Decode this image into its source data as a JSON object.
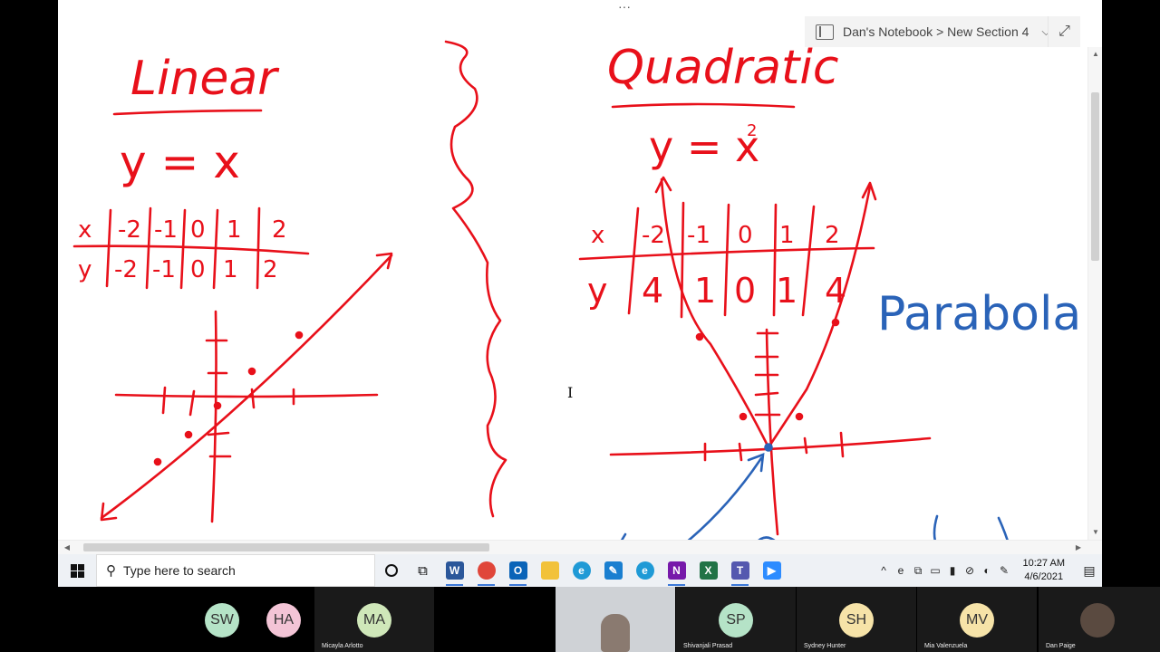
{
  "onenote": {
    "top_dots": "···",
    "notebook_path": "Dan's Notebook > New Section 4",
    "nb_caret": "⌵",
    "expand_glyph": "⤢",
    "close_glyph": "✕",
    "ibeam": "I"
  },
  "handwriting": {
    "linear_title": "Linear",
    "linear_eq": "y = x",
    "linear_x_row": [
      "x",
      "-2",
      "-1",
      "0",
      "1",
      "2"
    ],
    "linear_y_row": [
      "y",
      "-2",
      "-1",
      "0",
      "1",
      "2"
    ],
    "quadratic_title": "Quadratic",
    "quadratic_eq": "y = x",
    "quadratic_exp": "2",
    "quad_x_row": [
      "x",
      "-2",
      "-1",
      "0",
      "1",
      "2"
    ],
    "quad_y_row": [
      "y",
      "4",
      "1",
      "0",
      "1",
      "4"
    ],
    "parabola_label": "Parabola",
    "ink_red": "#e8101a",
    "ink_blue": "#2a63b8"
  },
  "taskbar": {
    "search_placeholder": "Type here to search",
    "apps": [
      {
        "name": "word-icon",
        "letter": "W",
        "color": "#2b579a"
      },
      {
        "name": "chrome-icon",
        "letter": "",
        "color": "#e0463a"
      },
      {
        "name": "outlook-icon",
        "letter": "O",
        "color": "#0a64b8"
      },
      {
        "name": "file-explorer-icon",
        "letter": "",
        "color": "#f2c23a"
      },
      {
        "name": "edge-icon",
        "letter": "e",
        "color": "#1f9ad6"
      },
      {
        "name": "app-icon",
        "letter": "✎",
        "color": "#1a7fd0"
      },
      {
        "name": "edge-legacy-icon",
        "letter": "e",
        "color": "#1f9ad6"
      },
      {
        "name": "onenote-icon",
        "letter": "N",
        "color": "#7719aa"
      },
      {
        "name": "excel-icon",
        "letter": "X",
        "color": "#217346"
      },
      {
        "name": "teams-icon",
        "letter": "T",
        "color": "#5558af"
      },
      {
        "name": "zoom-icon",
        "letter": "▶",
        "color": "#2d8cff"
      }
    ],
    "clock_time": "10:27 AM",
    "clock_date": "4/6/2021",
    "tray_glyphs": [
      "^",
      "e",
      "⧉",
      "▭",
      "▮",
      "⊘",
      "◐",
      "✎"
    ],
    "notification_glyph": "▤"
  },
  "participants": [
    {
      "initials": "SW",
      "name": "",
      "color": "#b5e3c7"
    },
    {
      "initials": "HA",
      "name": "",
      "color": "#f3c4d6"
    },
    {
      "initials": "MA",
      "name": "Micayla Arlotto",
      "color": "#cfe7b9"
    },
    {
      "initials": "",
      "name": "",
      "color": "#000000"
    },
    {
      "initials": "",
      "name": "",
      "color": "#b4b4b4"
    },
    {
      "initials": "SP",
      "name": "Shivanjali Prasad",
      "color": "#b5e3c7"
    },
    {
      "initials": "SH",
      "name": "Sydney Hunter",
      "color": "#f6e3a8"
    },
    {
      "initials": "MV",
      "name": "Mia Valenzuela",
      "color": "#f6e3a8"
    },
    {
      "initials": "",
      "name": "Dan Paige",
      "color": "#5a4a40"
    }
  ]
}
